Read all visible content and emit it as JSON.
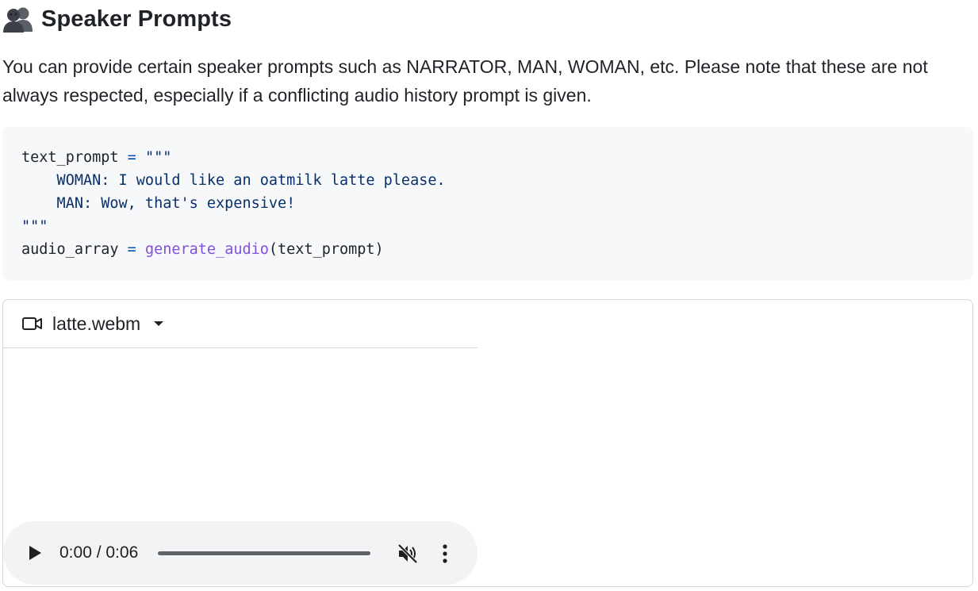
{
  "section": {
    "title": "Speaker Prompts",
    "icon": "people-icon",
    "description": "You can provide certain speaker prompts such as NARRATOR, MAN, WOMAN, etc. Please note that these are not always respected, especially if a conflicting audio history prompt is given."
  },
  "code": {
    "line1_var": "text_prompt",
    "line1_op": " = ",
    "line1_str": "\"\"\"",
    "line2": "    WOMAN: I would like an oatmilk latte please.",
    "line3": "    MAN: Wow, that's expensive!",
    "line4": "\"\"\"",
    "line5_var": "audio_array",
    "line5_op": " = ",
    "line5_fn": "generate_audio",
    "line5_args": "(text_prompt)"
  },
  "video": {
    "file_name": "latte.webm",
    "file_icon": "video-camera-icon",
    "dropdown_icon": "caret-down-icon",
    "player": {
      "time_display": "0:00 / 0:06",
      "progress": 0,
      "play_icon": "play-icon",
      "mute_icon": "muted-speaker-icon",
      "more_icon": "more-vertical-icon"
    }
  }
}
